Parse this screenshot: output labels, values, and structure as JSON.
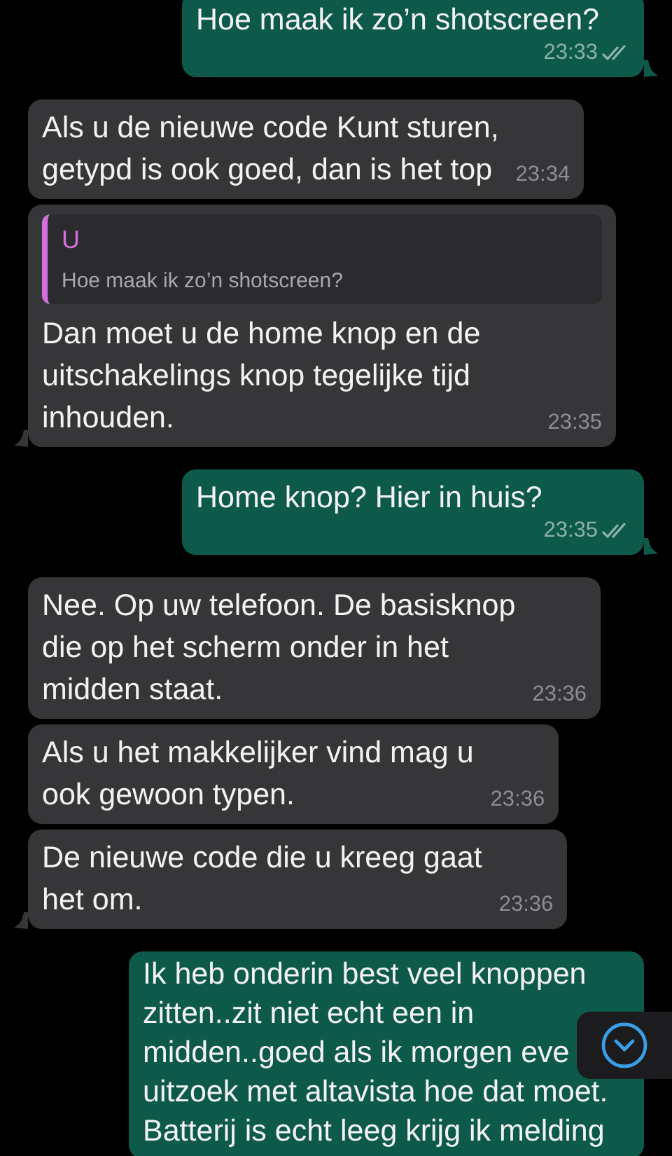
{
  "messages": [
    {
      "kind": "sent",
      "text": "Hoe maak ik zo’n shotscreen?",
      "time": "23:33",
      "read": false,
      "tail": true
    },
    {
      "kind": "received",
      "text": "Als u de nieuwe code Kunt sturen,\ngetypd is ook goed, dan is het top",
      "time": "23:34",
      "tail": false
    },
    {
      "kind": "received",
      "quote": {
        "author": "U",
        "text": "Hoe maak ik zo’n shotscreen?"
      },
      "text": "Dan moet u de home knop en de\nuitschakelings knop tegelijke tijd\ninhouden.",
      "time": "23:35",
      "tail": true
    },
    {
      "kind": "sent",
      "text": "Home knop? Hier in huis?",
      "time": "23:35",
      "read": false,
      "tail": true
    },
    {
      "kind": "received",
      "text": "Nee. Op uw telefoon. De basisknop\ndie op het scherm onder in het\nmidden staat.",
      "time": "23:36",
      "tail": false
    },
    {
      "kind": "received",
      "text": "Als u het makkelijker vind mag u\nook gewoon typen.",
      "time": "23:36",
      "tail": false
    },
    {
      "kind": "received",
      "text": "De nieuwe code die u kreeg gaat\nhet om.",
      "time": "23:36",
      "tail": true
    },
    {
      "kind": "sent",
      "text": "Ik heb onderin best veel knoppen\nzitten..zit niet echt een in\nmidden..goed als ik morgen eve\nuitzoek met altavista hoe dat moet.\nBatterij is echt leeg krijg ik melding"
    }
  ],
  "scroll_down_button": {
    "shown": true
  }
}
